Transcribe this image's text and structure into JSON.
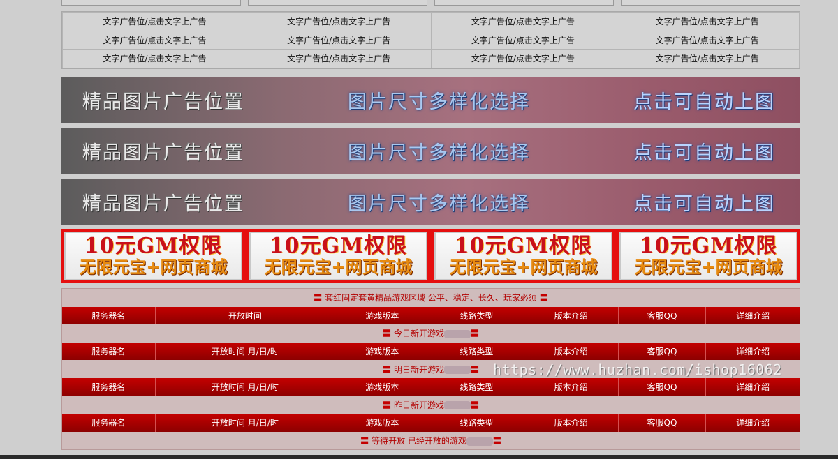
{
  "text_ad": "文字广告位/点击文字上广告",
  "text_ads_rows": 3,
  "text_ads_cols": 4,
  "image_banners": [
    {
      "left": "精品图片广告位置",
      "center": "图片尺寸多样化选择",
      "right": "点击可自动上图"
    },
    {
      "left": "精品图片广告位置",
      "center": "图片尺寸多样化选择",
      "right": "点击可自动上图"
    },
    {
      "left": "精品图片广告位置",
      "center": "图片尺寸多样化选择",
      "right": "点击可自动上图"
    }
  ],
  "gm_banners": [
    {
      "line1": "10元GM权限",
      "line2": "无限元宝+网页商城"
    },
    {
      "line1": "10元GM权限",
      "line2": "无限元宝+网页商城"
    },
    {
      "line1": "10元GM权限",
      "line2": "无限元宝+网页商城"
    },
    {
      "line1": "10元GM权限",
      "line2": "无限元宝+网页商城"
    }
  ],
  "server_sections": [
    {
      "title": "套红固定套黄精品游戏区域 公平、稳定、长久、玩家必须",
      "headers": [
        "服务器名",
        "开放时间",
        "游戏版本",
        "线路类型",
        "版本介绍",
        "客服QQ",
        "详细介绍"
      ]
    },
    {
      "title": "今日新开游戏",
      "headers": [
        "服务器名",
        "开放时间 月/日/时",
        "游戏版本",
        "线路类型",
        "版本介绍",
        "客服QQ",
        "详细介绍"
      ]
    },
    {
      "title": "明日新开游戏",
      "headers": [
        "服务器名",
        "开放时间 月/日/时",
        "游戏版本",
        "线路类型",
        "版本介绍",
        "客服QQ",
        "详细介绍"
      ]
    },
    {
      "title": "昨日新开游戏",
      "headers": [
        "服务器名",
        "开放时间 月/日/时",
        "游戏版本",
        "线路类型",
        "版本介绍",
        "客服QQ",
        "详细介绍"
      ]
    },
    {
      "title": "等待开放 已经开放的游戏",
      "headers": []
    }
  ],
  "section_marker": "〓",
  "watermark": "https://www.huzhan.com/ishop16062",
  "colors": {
    "header_red": "#b00000",
    "gm_border": "#e50f0f",
    "section_text": "#b30000"
  }
}
